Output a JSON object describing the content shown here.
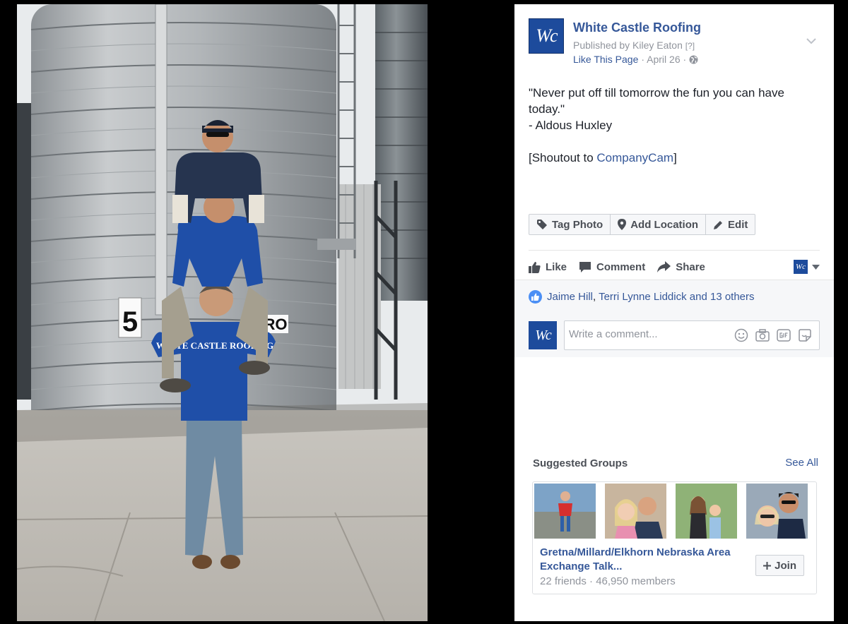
{
  "post": {
    "page_name": "White Castle Roofing",
    "page_initials": "Wc",
    "published_by": "Published by Kiley Eaton",
    "published_marker": "[?]",
    "like_page": "Like This Page",
    "date": "· April 26 ·",
    "text_line1": "\"Never put off till tomorrow the fun you can have today.\"",
    "text_line2": "- Aldous Huxley",
    "text_line3_prefix": "[Shoutout to ",
    "text_line3_link": "CompanyCam",
    "text_line3_suffix": "]"
  },
  "photo_actions": {
    "tag_photo": "Tag Photo",
    "add_location": "Add Location",
    "edit": "Edit"
  },
  "ufi": {
    "like": "Like",
    "comment": "Comment",
    "share": "Share"
  },
  "reactions": {
    "name1": "Jaime Hill",
    "separator": ",",
    "name2": "Terri Lynne Liddick",
    "rest": "and 13 others"
  },
  "comment_box": {
    "placeholder": "Write a comment..."
  },
  "suggested_groups": {
    "title": "Suggested Groups",
    "see_all": "See All",
    "group_name": "Gretna/Millard/Elkhorn Nebraska Area Exchange Talk...",
    "stats": "22 friends · 46,950 members",
    "join_label": "Join"
  },
  "photo_signage": {
    "silo_number": "5",
    "silo_label": "RO",
    "shirt_text": "WHITE CASTLE ROOFING"
  },
  "colors": {
    "link_blue": "#365899",
    "brand_blue": "#1d4b9c",
    "hoodie_blue": "#1f4fa8"
  }
}
